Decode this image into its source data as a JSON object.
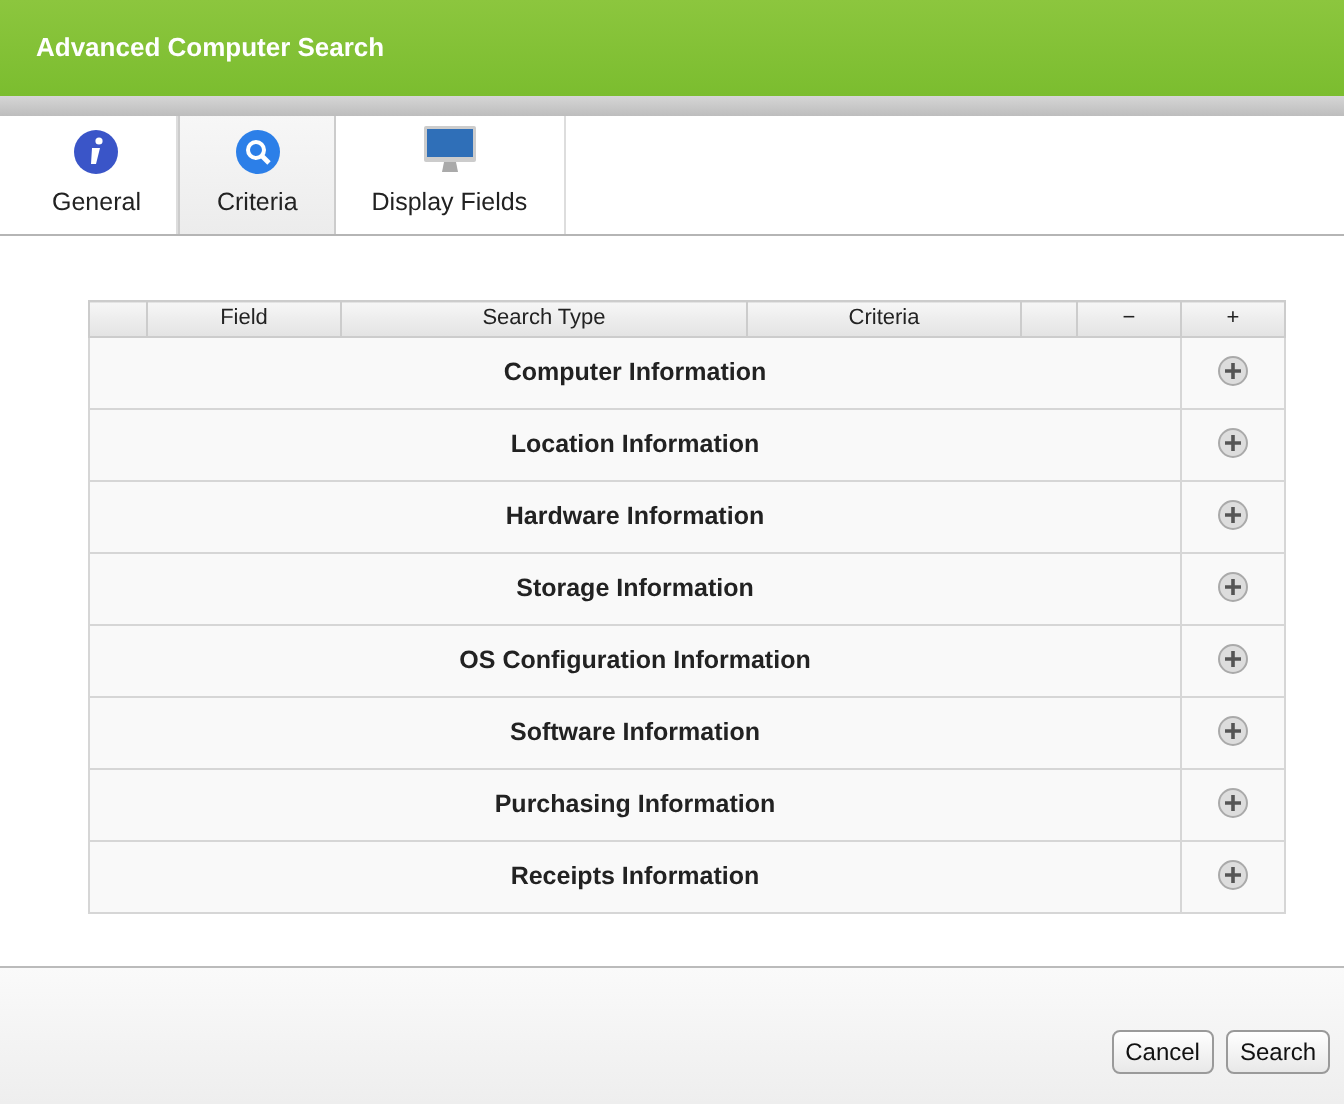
{
  "window": {
    "title": "Advanced Computer Search"
  },
  "tabs": [
    {
      "label": "General",
      "selected": false
    },
    {
      "label": "Criteria",
      "selected": true
    },
    {
      "label": "Display Fields",
      "selected": false
    }
  ],
  "table": {
    "columns": [
      "Field",
      "Search Type",
      "Criteria",
      "−",
      "+"
    ],
    "groups": [
      "Computer Information",
      "Location Information",
      "Hardware Information",
      "Storage Information",
      "OS Configuration Information",
      "Software Information",
      "Purchasing Information",
      "Receipts Information"
    ]
  },
  "buttons": [
    "Cancel",
    "Search"
  ]
}
